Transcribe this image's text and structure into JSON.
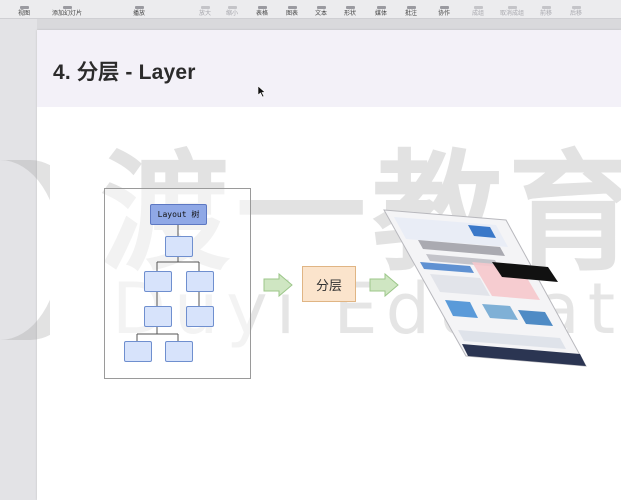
{
  "toolbar": {
    "items": [
      {
        "label": "视图",
        "enabled": true
      },
      {
        "label": "添加幻灯片",
        "enabled": true
      },
      {
        "label": "播放",
        "enabled": true
      },
      {
        "label": "放大",
        "enabled": false
      },
      {
        "label": "缩小",
        "enabled": false
      },
      {
        "label": "表格",
        "enabled": true
      },
      {
        "label": "图表",
        "enabled": true
      },
      {
        "label": "文本",
        "enabled": true
      },
      {
        "label": "形状",
        "enabled": true
      },
      {
        "label": "媒体",
        "enabled": true
      },
      {
        "label": "批注",
        "enabled": true
      },
      {
        "label": "协作",
        "enabled": true
      },
      {
        "label": "成组",
        "enabled": false
      },
      {
        "label": "取消成组",
        "enabled": false
      },
      {
        "label": "前移",
        "enabled": false
      },
      {
        "label": "后移",
        "enabled": false
      }
    ]
  },
  "slide": {
    "title": "4. 分层 - Layer",
    "diagram": {
      "layout_tree_label": "Layout 树",
      "layer_step_label": "分层"
    }
  },
  "watermark": {
    "chars": "渡一教育",
    "latin": "Duyi Education"
  },
  "colors": {
    "node_fill": "#d7e3fb",
    "node_border": "#6f8fcf",
    "root_fill": "#8fa8e6",
    "layer_box_fill": "#fbe4cc",
    "arrow_fill": "#cfe6c2",
    "header_bg": "#f3f1f8"
  }
}
